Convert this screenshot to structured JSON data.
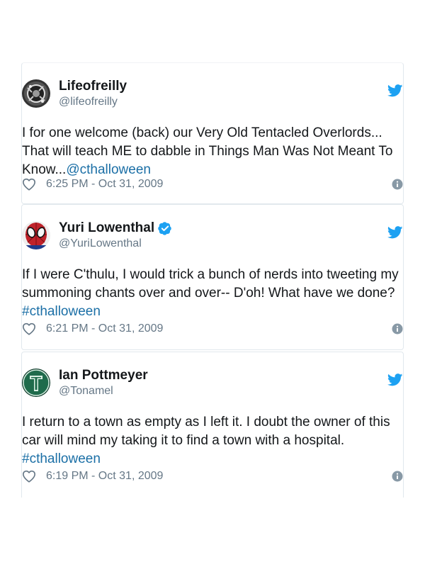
{
  "tweets": [
    {
      "name": "Lifeofreilly",
      "handle": "@lifeofreilly",
      "verified": false,
      "text_lines": [
        "I for one welcome (back) our Very Old Tentacled Overlords...",
        "That will teach ME to dabble in Things Man Was Not Meant To"
      ],
      "text_tail": "Know...",
      "link": "@cthalloween",
      "timestamp": "6:25 PM - Oct 31, 2009"
    },
    {
      "name": "Yuri Lowenthal",
      "handle": "@YuriLowenthal",
      "verified": true,
      "text_lines": [
        "If I were C'thulu, I would trick a bunch of nerds into tweeting my",
        "summoning chants over and over-- D'oh! What have we done?"
      ],
      "link": "#cthalloween",
      "timestamp": "6:21 PM - Oct 31, 2009"
    },
    {
      "name": "Ian Pottmeyer",
      "handle": "@Tonamel",
      "verified": false,
      "text_lines": [
        "I return to a town as empty as I left it. I doubt the owner of this",
        "car will mind my taking it to find a town with a hospital."
      ],
      "link": "#cthalloween",
      "timestamp": "6:19 PM - Oct 31, 2009"
    }
  ],
  "icons": {
    "bird": "twitter-bird-icon",
    "like": "heart-icon",
    "info": "info-icon",
    "verified": "verified-badge-icon"
  },
  "colors": {
    "accent": "#1da1f2",
    "link": "#1b6fa6",
    "secondary_text": "#657786",
    "border": "#e1e8ed"
  }
}
